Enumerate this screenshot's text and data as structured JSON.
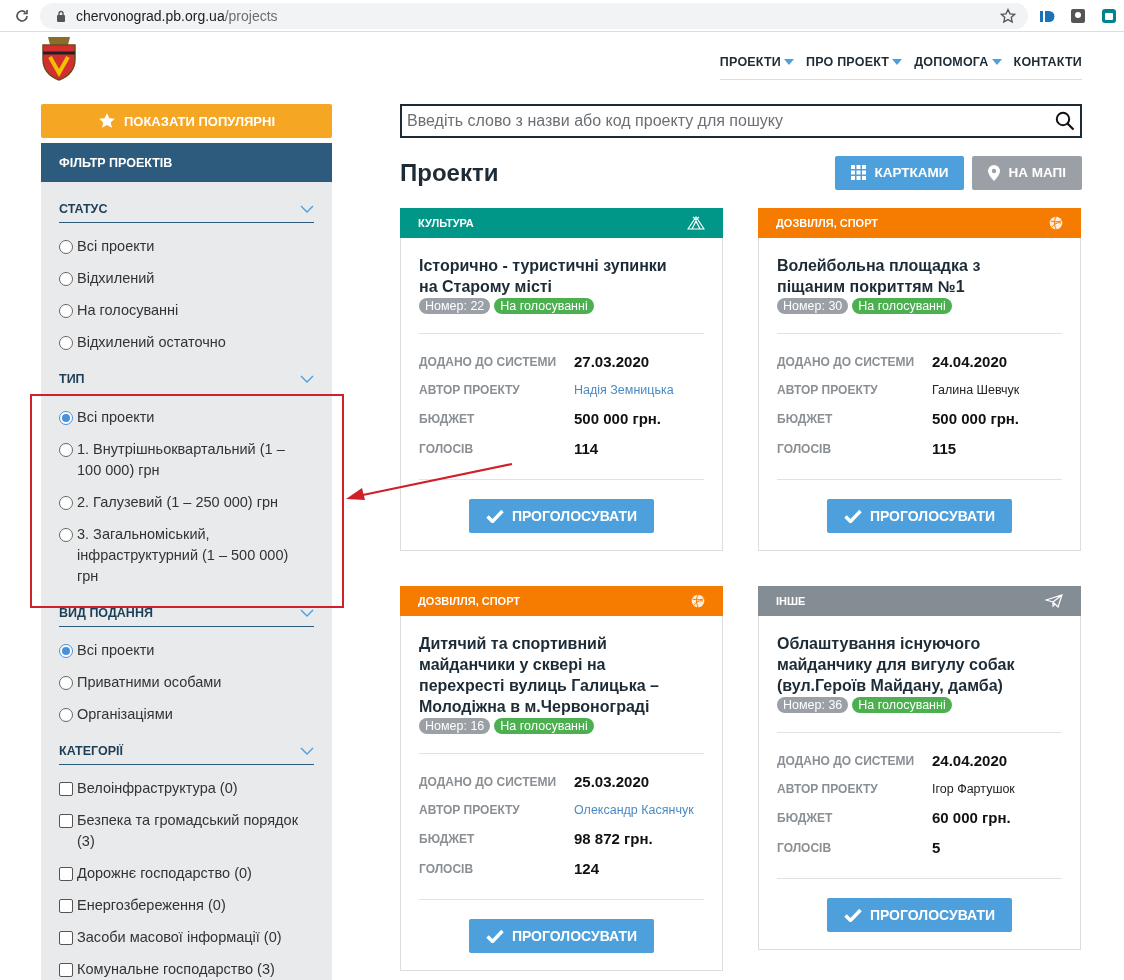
{
  "browser": {
    "url_host": "chervonograd.pb.org.ua",
    "url_path": "/projects"
  },
  "nav": [
    {
      "label": "ПРОЕКТИ",
      "dropdown": true
    },
    {
      "label": "ПРО ПРОЕКТ",
      "dropdown": true
    },
    {
      "label": "ДОПОМОГА",
      "dropdown": true
    },
    {
      "label": "КОНТАКТИ",
      "dropdown": false
    }
  ],
  "sidebar": {
    "popular_button": "ПОКАЗАТИ ПОПУЛЯРНІ",
    "filter_title": "ФІЛЬТР ПРОЕКТІВ",
    "groups": [
      {
        "title": "СТАТУС",
        "kind": "radio",
        "items": [
          {
            "label": "Всі проекти",
            "selected": false
          },
          {
            "label": "Відхилений",
            "selected": false
          },
          {
            "label": "На голосуванні",
            "selected": false
          },
          {
            "label": "Відхилений остаточно",
            "selected": false
          }
        ]
      },
      {
        "title": "ТИП",
        "kind": "radio",
        "items": [
          {
            "label": "Всі проекти",
            "selected": true
          },
          {
            "label": "1. Внутрішньоквартальний (1 – 100 000) грн",
            "selected": false
          },
          {
            "label": "2. Галузевий (1 – 250 000) грн",
            "selected": false
          },
          {
            "label": "3. Загальноміський, інфраструктурний (1 – 500 000) грн",
            "selected": false
          }
        ]
      },
      {
        "title": "ВИД ПОДАННЯ",
        "kind": "radio",
        "items": [
          {
            "label": "Всі проекти",
            "selected": true
          },
          {
            "label": "Приватними особами",
            "selected": false
          },
          {
            "label": "Організаціями",
            "selected": false
          }
        ]
      },
      {
        "title": "КАТЕГОРІЇ",
        "kind": "checkbox",
        "items": [
          {
            "label": "Велоінфраструктура (0)",
            "checked": false
          },
          {
            "label": "Безпека та громадський порядок (3)",
            "checked": false
          },
          {
            "label": "Дорожнє господарство (0)",
            "checked": false
          },
          {
            "label": "Енергозбереження (0)",
            "checked": false
          },
          {
            "label": "Засоби масової інформації (0)",
            "checked": false
          },
          {
            "label": "Комунальне господарство (3)",
            "checked": false
          }
        ]
      }
    ]
  },
  "search": {
    "placeholder": "Введіть слово з назви або код проекту для пошуку"
  },
  "heading": "Проекти",
  "view_buttons": [
    {
      "label": "КАРТКАМИ",
      "kind": "grid",
      "selected": true
    },
    {
      "label": "НА МАПІ",
      "kind": "pin",
      "selected": false
    }
  ],
  "cards": [
    {
      "category": "КУЛЬТУРА",
      "color": "#009688",
      "kind": "tent",
      "title": "Історично - туристичні зупинки на Старому місті",
      "number": "Номер: 22",
      "status": "На голосуванні",
      "fields": [
        {
          "label": "ДОДАНО ДО СИСТЕМИ",
          "value": "27.03.2020",
          "kind": "bold"
        },
        {
          "label": "АВТОР ПРОЕКТУ",
          "value": "Надія Земницька",
          "kind": "link"
        },
        {
          "label": "БЮДЖЕТ",
          "value": "500 000 грн.",
          "kind": "bold"
        },
        {
          "label": "ГОЛОСІВ",
          "value": "114",
          "kind": "bold"
        }
      ],
      "button": "ПРОГОЛОСУВАТИ"
    },
    {
      "category": "ДОЗВІЛЛЯ, СПОРТ",
      "color": "#f57c00",
      "kind": "ball",
      "title": "Волейбольна площадка з піщаним покриттям №1",
      "number": "Номер: 30",
      "status": "На голосуванні",
      "fields": [
        {
          "label": "ДОДАНО ДО СИСТЕМИ",
          "value": "24.04.2020",
          "kind": "bold"
        },
        {
          "label": "АВТОР ПРОЕКТУ",
          "value": "Галина Шевчук",
          "kind": "plain"
        },
        {
          "label": "БЮДЖЕТ",
          "value": "500 000 грн.",
          "kind": "bold"
        },
        {
          "label": "ГОЛОСІВ",
          "value": "115",
          "kind": "bold"
        }
      ],
      "button": "ПРОГОЛОСУВАТИ"
    },
    {
      "category": "ДОЗВІЛЛЯ, СПОРТ",
      "color": "#f57c00",
      "kind": "ball",
      "title": "Дитячий та спортивний майданчики у сквері на перехресті вулиць Галицька – Молодіжна в м.Червонограді",
      "number": "Номер: 16",
      "status": "На голосуванні",
      "fields": [
        {
          "label": "ДОДАНО ДО СИСТЕМИ",
          "value": "25.03.2020",
          "kind": "bold"
        },
        {
          "label": "АВТОР ПРОЕКТУ",
          "value": "Олександр Касянчук",
          "kind": "link"
        },
        {
          "label": "БЮДЖЕТ",
          "value": "98 872 грн.",
          "kind": "bold"
        },
        {
          "label": "ГОЛОСІВ",
          "value": "124",
          "kind": "bold"
        }
      ],
      "button": "ПРОГОЛОСУВАТИ"
    },
    {
      "category": "ІНШЕ",
      "color": "#848c94",
      "kind": "plane",
      "title": "Облаштування існуючого майданчику для вигулу собак (вул.Героїв Майдану, дамба)",
      "number": "Номер: 36",
      "status": "На голосуванні",
      "fields": [
        {
          "label": "ДОДАНО ДО СИСТЕМИ",
          "value": "24.04.2020",
          "kind": "bold"
        },
        {
          "label": "АВТОР ПРОЕКТУ",
          "value": "Ігор Фартушок",
          "kind": "plain"
        },
        {
          "label": "БЮДЖЕТ",
          "value": "60 000 грн.",
          "kind": "bold"
        },
        {
          "label": "ГОЛОСІВ",
          "value": "5",
          "kind": "bold"
        }
      ],
      "button": "ПРОГОЛОСУВАТИ"
    }
  ]
}
